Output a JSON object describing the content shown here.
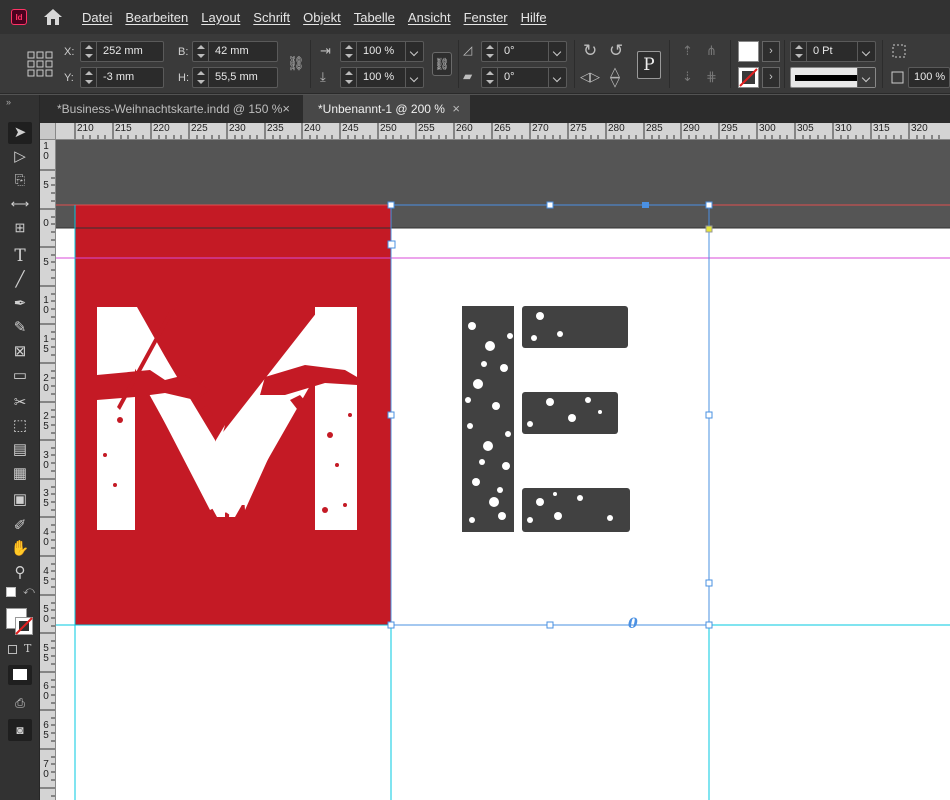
{
  "menu": {
    "app_icon_text": "Id",
    "items": [
      "Datei",
      "Bearbeiten",
      "Layout",
      "Schrift",
      "Objekt",
      "Tabelle",
      "Ansicht",
      "Fenster",
      "Hilfe"
    ]
  },
  "control": {
    "x_label": "X:",
    "x_value": "252 mm",
    "y_label": "Y:",
    "y_value": "-3 mm",
    "w_label": "B:",
    "w_value": "42 mm",
    "h_label": "H:",
    "h_value": "55,5 mm",
    "scale_x": "100 %",
    "scale_y": "100 %",
    "angle": "0°",
    "shear": "0°",
    "stroke_weight": "0 Pt",
    "opacity": "100 %",
    "paragraph_icon": "P"
  },
  "tabs": [
    {
      "label": "*Business-Weihnachtskarte.indd @ 150 %",
      "close": "×"
    },
    {
      "label": "*Unbenannt-1 @ 200 %",
      "close": "×"
    }
  ],
  "ruler_h": [
    "210",
    "215",
    "220",
    "225",
    "230",
    "235",
    "240",
    "245",
    "250",
    "255",
    "260",
    "265",
    "270",
    "275",
    "280",
    "285",
    "290",
    "295",
    "300",
    "305",
    "310",
    "315",
    "320"
  ],
  "ruler_v": [
    "1 0",
    "5",
    "0",
    "5",
    "1 0",
    "1 5",
    "2 0",
    "2 5",
    "3 0",
    "3 5",
    "4 0",
    "4 5",
    "5 0",
    "5 5",
    "6 0",
    "6 5",
    "7 0"
  ],
  "artwork": {
    "left_letter": "M",
    "right_letter": "E"
  },
  "colors": {
    "red_frame": "#c41a25",
    "letter_e": "#414141",
    "selection": "#4a90e2",
    "guide_cyan": "#00c8e0",
    "guide_magenta": "#d84bd8",
    "bleed_red": "#e05050"
  },
  "text_wrap_marker": "0",
  "tool_icons": [
    "selection-icon",
    "direct-selection-icon",
    "page-tool-icon",
    "gap-tool-icon",
    "content-collector-icon",
    "type-tool-icon",
    "line-tool-icon",
    "pen-tool-icon",
    "pencil-tool-icon",
    "rectangle-frame-icon",
    "rectangle-icon",
    "scissors-icon",
    "free-transform-icon",
    "gradient-swatch-icon",
    "gradient-feather-icon",
    "note-tool-icon",
    "eyedropper-icon",
    "hand-tool-icon",
    "zoom-tool-icon",
    "fill-stroke-icon",
    "normal-view-icon",
    "screen-mode-icon"
  ]
}
